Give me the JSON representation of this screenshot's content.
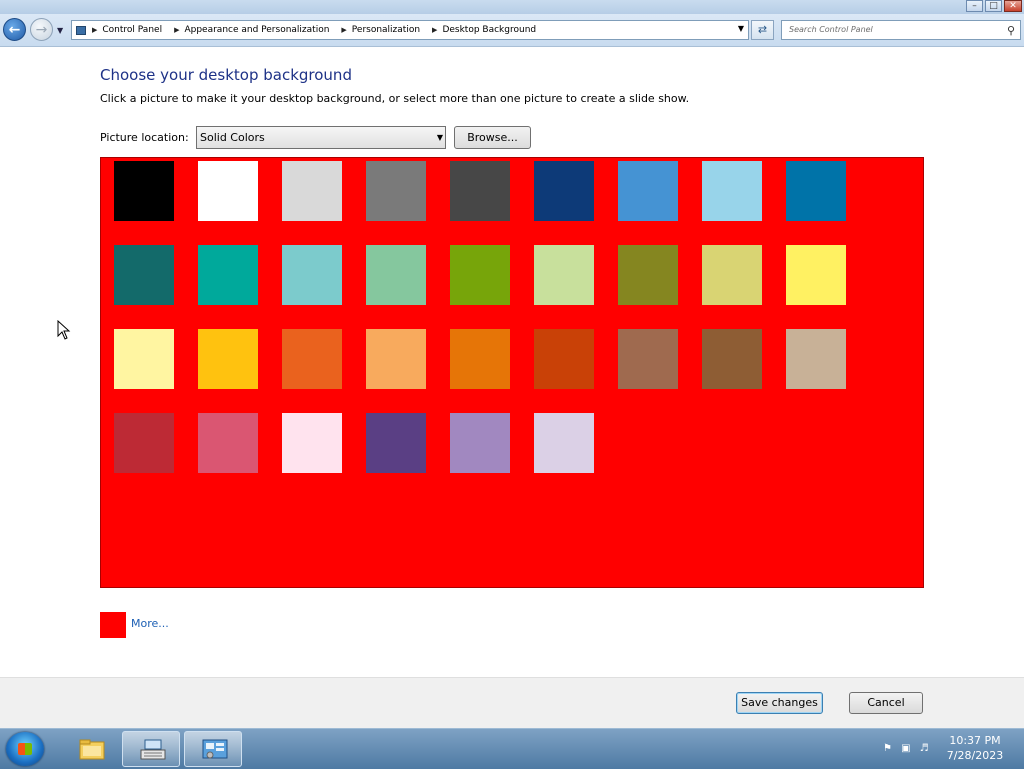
{
  "window": {
    "buttons": {
      "minimize": "–",
      "maximize": "□",
      "close": "✕"
    }
  },
  "nav": {
    "breadcrumbs": [
      "Control Panel",
      "Appearance and Personalization",
      "Personalization",
      "Desktop Background"
    ],
    "search_placeholder": "Search Control Panel",
    "icons": {
      "back": "arrow-left-icon",
      "forward": "arrow-right-icon",
      "refresh": "refresh-icon",
      "search": "search-icon"
    }
  },
  "main": {
    "title": "Choose your desktop background",
    "subtitle": "Click a picture to make it your desktop background, or select more than one picture to create a slide show.",
    "location_label": "Picture location:",
    "location_value": "Solid Colors",
    "browse_label": "Browse...",
    "gallery_background": "#ff0000",
    "swatches": [
      "#000000",
      "#ffffff",
      "#d9d9d9",
      "#7a7a7a",
      "#474747",
      "#0d3a78",
      "#4593d3",
      "#98d4ea",
      "#0073a8",
      "#136a6a",
      "#00a99b",
      "#7ccbcc",
      "#85c79e",
      "#77a50a",
      "#c8e09c",
      "#858620",
      "#d9d473",
      "#fff162",
      "#fff5a1",
      "#ffc20f",
      "#ea621e",
      "#f8aa5d",
      "#e67507",
      "#c94107",
      "#9f6a4f",
      "#8e5d34",
      "#c8b197",
      "#bd2a35",
      "#da5672",
      "#ffe3ee",
      "#5a3f84",
      "#a188c0",
      "#dbd0e6"
    ],
    "more_label": "More...",
    "more_color": "#ff0000"
  },
  "footer": {
    "save_label": "Save changes",
    "cancel_label": "Cancel"
  },
  "taskbar": {
    "time": "10:37 PM",
    "date": "7/28/2023",
    "apps": [
      "folder-icon",
      "keyboard-icon",
      "control-panel-icon"
    ]
  }
}
